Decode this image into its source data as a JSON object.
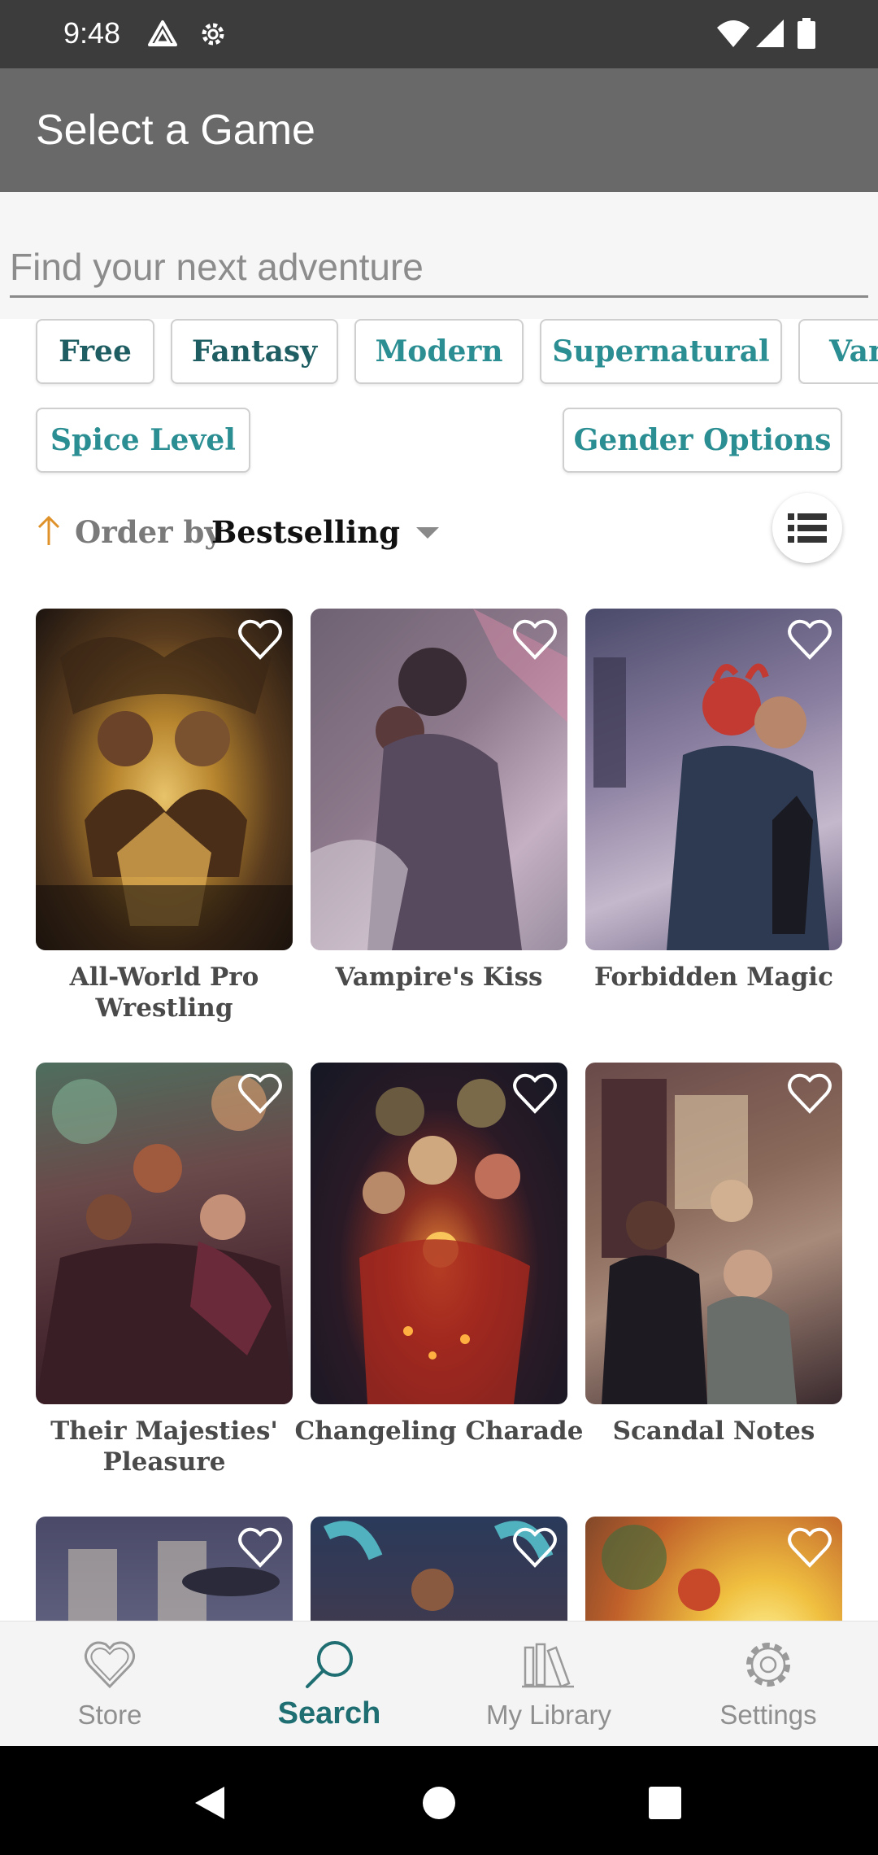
{
  "status_bar": {
    "time": "9:48"
  },
  "app_bar": {
    "title": "Select a Game"
  },
  "search": {
    "placeholder": "Find your next adventure",
    "value": ""
  },
  "filters": {
    "genre_chips": [
      {
        "label": "Free"
      },
      {
        "label": "Fantasy"
      },
      {
        "label": "Modern"
      },
      {
        "label": "Supernatural"
      },
      {
        "label": "Vampire"
      }
    ],
    "spice_level": "Spice Level",
    "gender_options": "Gender Options"
  },
  "sort": {
    "label": "Order by",
    "value": "Bestselling"
  },
  "games": [
    {
      "title": "All-World Pro Wrestling"
    },
    {
      "title": "Vampire's Kiss"
    },
    {
      "title": "Forbidden Magic"
    },
    {
      "title": "Their Majesties' Pleasure"
    },
    {
      "title": "Changeling Charade"
    },
    {
      "title": "Scandal Notes"
    },
    {
      "title": ""
    },
    {
      "title": ""
    },
    {
      "title": ""
    }
  ],
  "bottom_nav": {
    "items": [
      {
        "label": "Store"
      },
      {
        "label": "Search"
      },
      {
        "label": "My Library"
      },
      {
        "label": "Settings"
      }
    ],
    "active": "Search"
  },
  "colors": {
    "accent": "#2a8e92",
    "app_bar": "#696969",
    "status_bar": "#3c3c3c"
  }
}
